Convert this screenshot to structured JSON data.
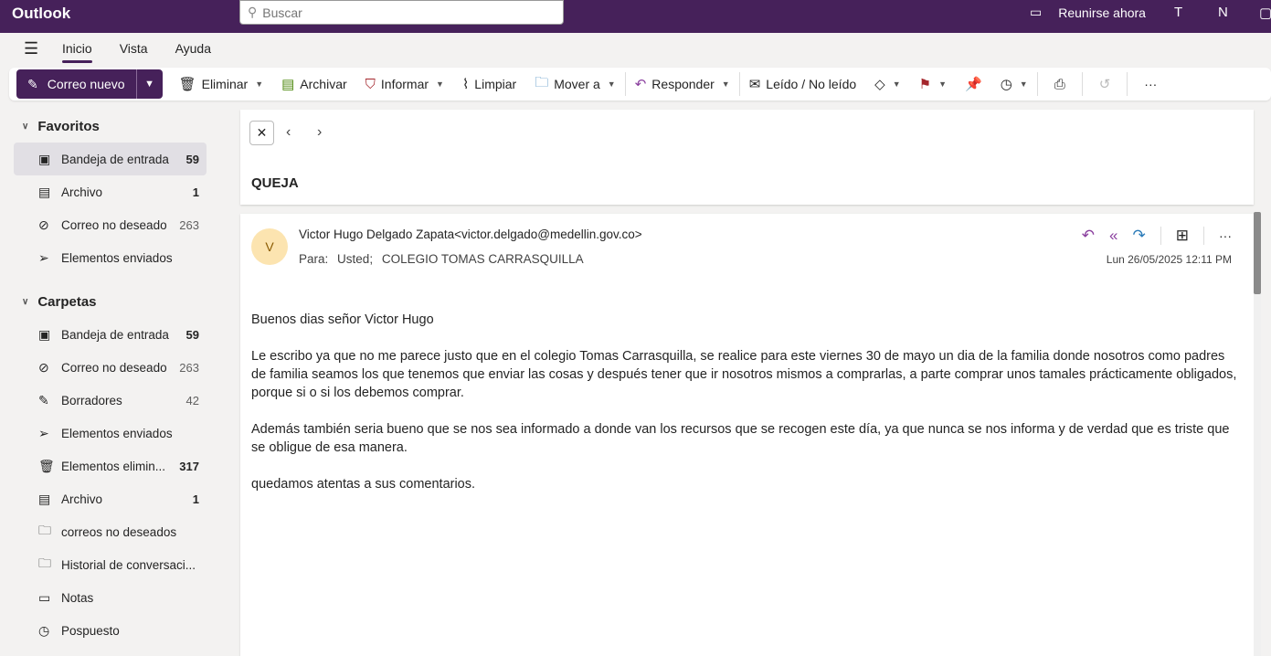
{
  "app": {
    "title": "Outlook",
    "search_placeholder": "Buscar",
    "meet_now": "Reunirse ahora"
  },
  "tabs": [
    {
      "label": "Inicio",
      "active": true
    },
    {
      "label": "Vista"
    },
    {
      "label": "Ayuda"
    }
  ],
  "toolbar": {
    "new_mail": "Correo nuevo",
    "delete": "Eliminar",
    "archive": "Archivar",
    "report": "Informar",
    "sweep": "Limpiar",
    "move": "Mover a",
    "reply": "Responder",
    "read_unread": "Leído / No leído",
    "more": "···"
  },
  "nav": {
    "favorites_label": "Favoritos",
    "favorites": [
      {
        "label": "Bandeja de entrada",
        "count": "59",
        "icon": "inbox-icon",
        "selected": true
      },
      {
        "label": "Archivo",
        "count": "1",
        "icon": "archive-icon"
      },
      {
        "label": "Correo no deseado",
        "count": "263",
        "icon": "junk-icon",
        "light": true
      },
      {
        "label": "Elementos enviados",
        "count": "",
        "icon": "send-icon"
      }
    ],
    "folders_label": "Carpetas",
    "folders": [
      {
        "label": "Bandeja de entrada",
        "count": "59",
        "icon": "inbox-icon"
      },
      {
        "label": "Correo no deseado",
        "count": "263",
        "icon": "junk-icon",
        "light": true
      },
      {
        "label": "Borradores",
        "count": "42",
        "icon": "draft-icon",
        "light": true
      },
      {
        "label": "Elementos enviados",
        "count": "",
        "icon": "send-icon"
      },
      {
        "label": "Elementos elimin...",
        "count": "317",
        "icon": "trash-icon"
      },
      {
        "label": "Archivo",
        "count": "1",
        "icon": "archive-icon"
      },
      {
        "label": "correos no deseados",
        "count": "",
        "icon": "folder-icon"
      },
      {
        "label": "Historial de conversaci...",
        "count": "",
        "icon": "folder-icon"
      },
      {
        "label": "Notas",
        "count": "",
        "icon": "note-icon"
      },
      {
        "label": "Pospuesto",
        "count": "",
        "icon": "clock-icon"
      }
    ]
  },
  "message": {
    "subject": "QUEJA",
    "avatar_initial": "V",
    "from": "Victor Hugo Delgado Zapata<victor.delgado@medellin.gov.co>",
    "to_label": "Para:",
    "to": [
      "Usted;",
      "COLEGIO TOMAS CARRASQUILLA"
    ],
    "date": "Lun 26/05/2025 12:11 PM",
    "more": "···",
    "body": [
      "Buenos dias señor Victor Hugo",
      "Le escribo ya que no me parece justo que en el colegio Tomas Carrasquilla, se realice para este viernes 30 de mayo un dia de la familia donde nosotros como padres de familia seamos los que tenemos que enviar las cosas y después tener que ir nosotros mismos a comprarlas, a parte comprar unos tamales prácticamente obligados, porque si o si los debemos comprar.",
      "Además también seria bueno que se nos sea informado a donde van los recursos que se recogen este día,  ya que nunca se nos informa y de verdad que es triste que se obligue de esa manera.",
      "quedamos atentas a sus comentarios."
    ]
  },
  "colors": {
    "brand": "#46215a",
    "accent_reply": "#8a3f9e",
    "accent_forward": "#2b7bb9"
  }
}
